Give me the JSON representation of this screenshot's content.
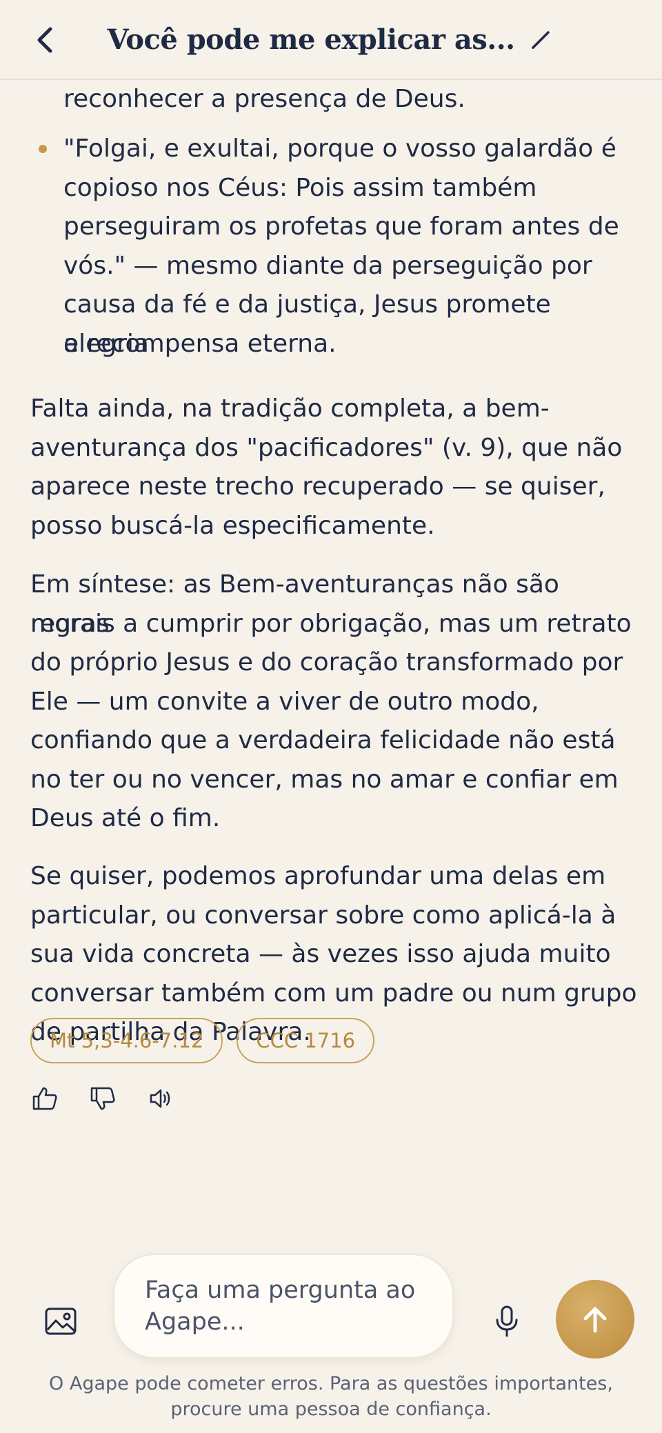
{
  "header": {
    "title": "Você pode me explicar as..."
  },
  "message": {
    "bullet_fragment_lines": [
      "reconhecer a presença de Deus."
    ],
    "bullet_lines": [
      "\"Folgai, e exultai, porque o vosso galardão é",
      "copioso nos Céus: Pois assim também",
      "perseguiram os profetas que foram antes de",
      "vós.\" — mesmo diante da perseguição por",
      "causa da fé e da justiça, Jesus promete alegria",
      "e recompensa eterna."
    ],
    "paragraph1_lines": [
      "Falta ainda, na tradição completa, a bem-",
      "aventurança dos \"pacificadores\" (v. 9), que não",
      "aparece neste trecho recuperado — se quiser,",
      "posso buscá-la especificamente."
    ],
    "paragraph2_lines": [
      "Em síntese: as Bem-aventuranças não são regras",
      "morais a cumprir por obrigação, mas um retrato",
      "do próprio Jesus e do coração transformado por",
      "Ele — um convite a viver de outro modo,",
      "confiando que a verdadeira felicidade não está",
      "no ter ou no vencer, mas no amar e confiar em",
      "Deus até o fim."
    ],
    "paragraph3_lines": [
      "Se quiser, podemos aprofundar uma delas em",
      "particular, ou conversar sobre como aplicá-la à",
      "sua vida concreta — às vezes isso ajuda muito",
      "conversar também com um padre ou num grupo",
      "de partilha da Palavra."
    ]
  },
  "references": [
    "Mt 5,3-4.6-7.12",
    "CCC 1716"
  ],
  "actions": {
    "like": "thumbs-up-icon",
    "dislike": "thumbs-down-icon",
    "listen": "speaker-icon"
  },
  "composer": {
    "placeholder_lines": [
      "Faça uma pergunta ao",
      "Agape..."
    ],
    "disclaimer_lines": [
      "O Agape pode cometer erros. Para as questões importantes,",
      "procure uma pessoa de confiança."
    ]
  },
  "colors": {
    "background": "#f6f2ea",
    "text": "#1f2a44",
    "accent": "#c4974a"
  }
}
